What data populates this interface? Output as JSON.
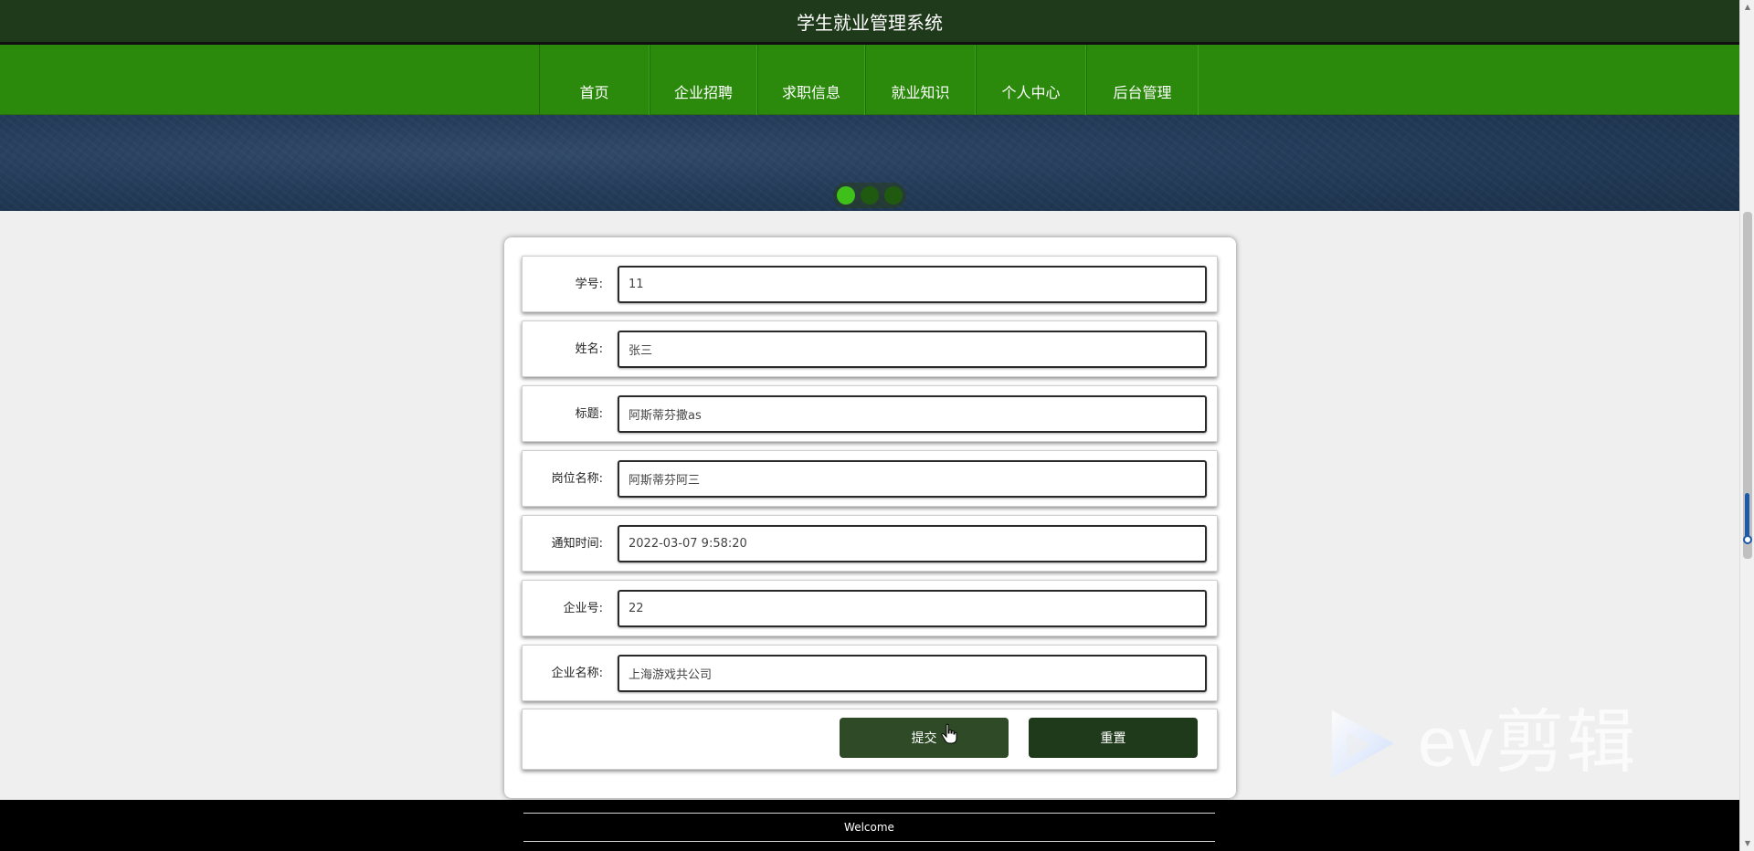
{
  "header": {
    "title": "学生就业管理系统"
  },
  "nav": {
    "items": [
      {
        "label": "首页"
      },
      {
        "label": "企业招聘"
      },
      {
        "label": "求职信息"
      },
      {
        "label": "就业知识"
      },
      {
        "label": "个人中心"
      },
      {
        "label": "后台管理"
      }
    ]
  },
  "carousel": {
    "slide_count": 3,
    "active_index": 0,
    "active_color": "#3fbf1a",
    "inactive_color": "#1f5a10"
  },
  "form": {
    "fields": [
      {
        "label": "学号:",
        "value": "11"
      },
      {
        "label": "姓名:",
        "value": "张三"
      },
      {
        "label": "标题:",
        "value": "阿斯蒂芬撒as"
      },
      {
        "label": "岗位名称:",
        "value": "阿斯蒂芬阿三"
      },
      {
        "label": "通知时间:",
        "value": "2022-03-07 9:58:20"
      },
      {
        "label": "企业号:",
        "value": "22"
      },
      {
        "label": "企业名称:",
        "value": "上海游戏共公司"
      }
    ],
    "submit_label": "提交",
    "reset_label": "重置"
  },
  "footer": {
    "text": "Welcome"
  },
  "watermark": {
    "text": "ev剪辑"
  },
  "colors": {
    "header_bg": "#1f3a1a",
    "nav_bg": "#2b8a0b",
    "button_bg": "#1f3a1a",
    "footer_bg": "#000000"
  }
}
